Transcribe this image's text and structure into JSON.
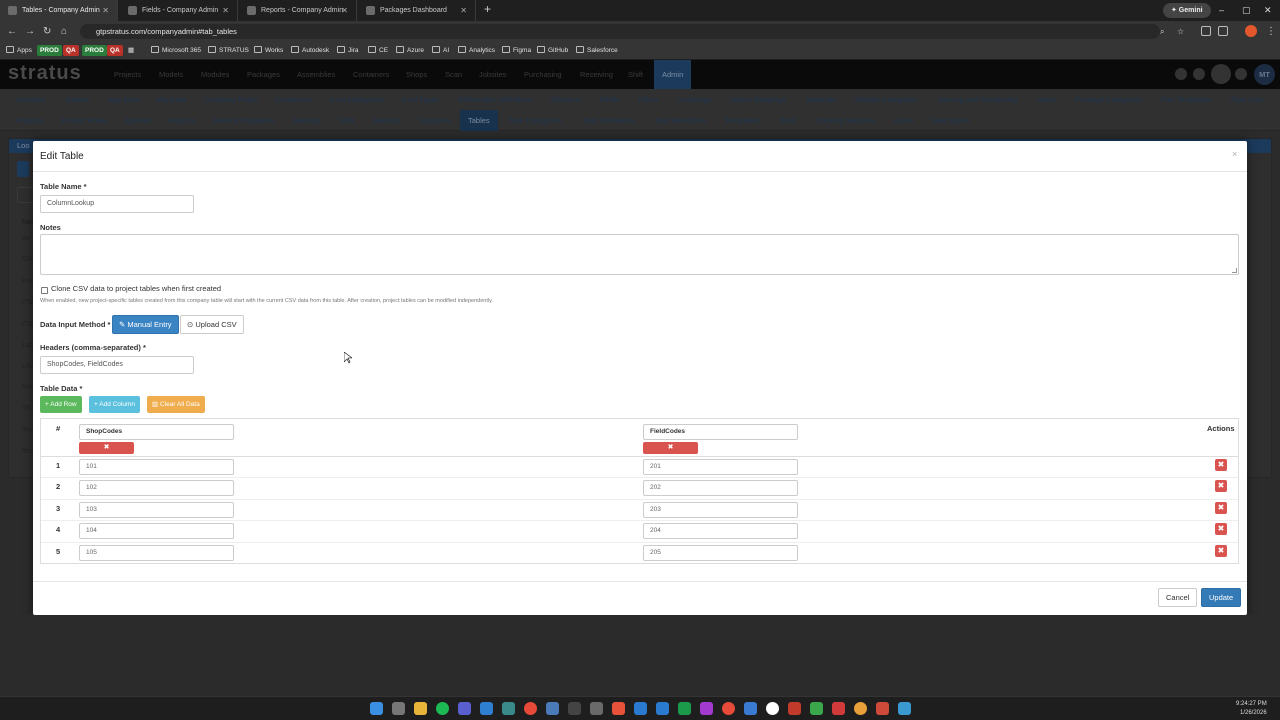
{
  "browser": {
    "tabs": [
      {
        "title": "Tables - Company Admin",
        "active": true
      },
      {
        "title": "Fields - Company Admin",
        "active": false
      },
      {
        "title": "Reports - Company Admin",
        "active": false
      },
      {
        "title": "Packages Dashboard",
        "active": false
      }
    ],
    "new_tab": "+",
    "gemini": "✦ Gemini",
    "url": "gtpstratus.com/companyadmin#tab_tables",
    "window_controls": [
      "–",
      "▢",
      "✕"
    ]
  },
  "bookmarks": [
    {
      "label": "Apps"
    },
    {
      "label": "PROD",
      "pill_color": "#2a7d3a"
    },
    {
      "label": "QA",
      "pill_color": "#c0392b"
    },
    {
      "label": "PROD",
      "pill_color": "#2a7d3a"
    },
    {
      "label": "QA",
      "pill_color": "#c0392b"
    },
    {
      "label": "Microsoft 365"
    },
    {
      "label": "STRATUS"
    },
    {
      "label": "Works"
    },
    {
      "label": "Autodesk"
    },
    {
      "label": "Jira"
    },
    {
      "label": "CE"
    },
    {
      "label": "Azure"
    },
    {
      "label": "AI"
    },
    {
      "label": "Analytics"
    },
    {
      "label": "Figma"
    },
    {
      "label": "GitHub"
    },
    {
      "label": "Salesforce"
    }
  ],
  "app": {
    "logo": "stratus",
    "main_nav": [
      "Projects",
      "Models",
      "Modules",
      "Packages",
      "Assemblies",
      "Containers",
      "Shops",
      "Scan",
      "Jobsites",
      "Purchasing",
      "Receiving",
      "Shift",
      "Admin"
    ],
    "active_main": "Admin",
    "avatar": "MT",
    "subnav_row1": [
      "Activities",
      "Aliases",
      "App Keys",
      "Big Data",
      "Company Roles",
      "Containers",
      "Cost Categories",
      "Cost Types",
      "Deliverable Definitions",
      "Divisions",
      "Fields",
      "Filters",
      "Groupings",
      "Import Mappings",
      "Materials",
      "Module Categories",
      "Naming and Numbering",
      "Notes",
      "Package Categories",
      "Part Templates",
      "Pipe Cuts"
    ],
    "subnav_row2": [
      "Projects",
      "Project Roles",
      "Queries",
      "Reports",
      "Service Templates",
      "Settings",
      "Shift",
      "Stations",
      "Suppliers",
      "Tables",
      "Task Categories",
      "Task Definitions",
      "Task Workflows",
      "Templates",
      "Tools",
      "Tracking Statuses",
      "Users",
      "View Styles"
    ],
    "active_sub": "Tables"
  },
  "background_panel": {
    "header": "Loo",
    "rows": [
      "Nar",
      "Arr",
      "Col",
      "Fee",
      "ITM",
      "ITM",
      "Lab",
      "Like",
      "Ser",
      "TES",
      "Tes",
      "Tes"
    ]
  },
  "modal": {
    "title": "Edit Table",
    "close": "×",
    "table_name_label": "Table Name *",
    "table_name_value": "ColumnLookup",
    "notes_label": "Notes",
    "notes_value": "",
    "clone_label": "Clone CSV data to project tables when first created",
    "clone_checked": false,
    "clone_help": "When enabled, new project-specific tables created from this company table will start with the current CSV data from this table. After creation, project tables can be modified independently.",
    "input_method_label": "Data Input Method *",
    "manual_entry": "Manual Entry",
    "upload_csv": "Upload CSV",
    "headers_label": "Headers (comma-separated) *",
    "headers_value": "ShopCodes, FieldCodes",
    "table_data_label": "Table Data *",
    "add_row": "+ Add Row",
    "add_column": "+ Add Column",
    "clear_all": "Clear All Data",
    "table": {
      "hash": "#",
      "actions": "Actions",
      "columns": [
        "ShopCodes",
        "FieldCodes"
      ],
      "rows": [
        {
          "num": "1",
          "cells": [
            "101",
            "201"
          ]
        },
        {
          "num": "2",
          "cells": [
            "102",
            "202"
          ]
        },
        {
          "num": "3",
          "cells": [
            "103",
            "203"
          ]
        },
        {
          "num": "4",
          "cells": [
            "104",
            "204"
          ]
        },
        {
          "num": "5",
          "cells": [
            "105",
            "205"
          ]
        }
      ]
    },
    "cancel": "Cancel",
    "update": "Update"
  },
  "taskbar": {
    "time": "9:24:27 PM",
    "date": "1/26/2026"
  },
  "colors": {
    "primary": "#337ab7",
    "success": "#5cb85c",
    "info": "#5bc0de",
    "warning": "#f0ad4e",
    "danger": "#d9534f",
    "nav_active": "#1b3a5c"
  }
}
